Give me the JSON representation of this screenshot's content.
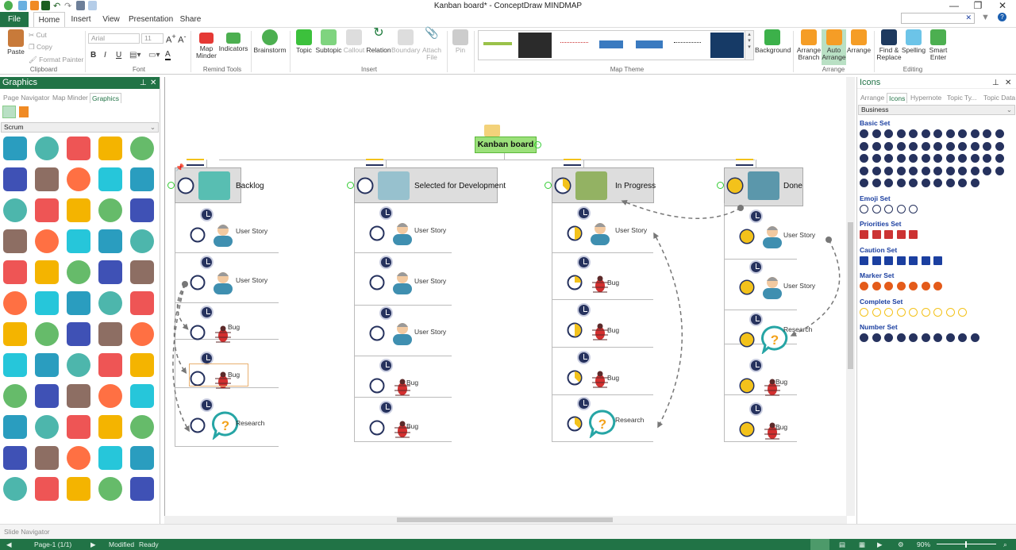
{
  "window": {
    "title": "Kanban board* - ConceptDraw MINDMAP",
    "minimize": "—",
    "restore": "❐",
    "close": "✕"
  },
  "tabs": {
    "file": "File",
    "items": [
      "Home",
      "Insert",
      "View",
      "Presentation",
      "Share"
    ]
  },
  "ribbon": {
    "clipboard": {
      "paste": "Paste",
      "cut": "Cut",
      "copy": "Copy",
      "format_painter": "Format Painter",
      "label": "Clipboard"
    },
    "font": {
      "name": "Arial",
      "size": "11",
      "bold": "B",
      "italic": "I",
      "underline": "U",
      "color": "A",
      "label": "Font"
    },
    "remind": {
      "map_minder": "Map Minder",
      "indicators": "Indicators",
      "label": "Remind Tools"
    },
    "brainstorm": "Brainstorm",
    "insert": {
      "items": [
        "Topic",
        "Subtopic",
        "Callout",
        "Relation",
        "Boundary",
        "Attach File"
      ],
      "label": "Insert"
    },
    "pin": "Pin",
    "map_theme": {
      "label": "Map Theme",
      "background": "Background"
    },
    "arrange": {
      "items": [
        "Arrange Branch",
        "Auto Arrange",
        "Arrange"
      ],
      "label": "Arrange"
    },
    "editing": {
      "items": [
        "Find & Replace",
        "Spelling",
        "Smart Enter"
      ],
      "label": "Editing"
    }
  },
  "left_panel": {
    "title": "Graphics",
    "tabs": [
      "Page Navigator",
      "Map Minder",
      "Graphics"
    ],
    "category": "Scrum",
    "icons": [
      "checklist",
      "gear",
      "chat-alert",
      "calendar",
      "businessman",
      "team",
      "bug",
      "chart-down",
      "chart-up",
      "manager",
      "team-meeting",
      "signpost",
      "document-check",
      "gears-people",
      "speech-question",
      "document",
      "check-circle",
      "worker-laptop",
      "ruler-triangle",
      "exclamation",
      "lock",
      "growth-chart",
      "dots-circle",
      "down-arrow",
      "ellipsis-circle",
      "mvp-box",
      "settings-people",
      "truck",
      "warning",
      "list-panel",
      "person-box",
      "open-box",
      "question-bubble",
      "question-bubbles",
      "error-circle",
      "pencil-ruler",
      "hand-document",
      "kanban-board",
      "presenter",
      "team-circle",
      "network",
      "sticky-notes",
      "cycle-person",
      "refresh-arrow",
      "task-list",
      "target",
      "sticky-note",
      "circular-arrow",
      "money-gears",
      "meeting-group",
      "leader-flag",
      "businessman-2",
      "thumbs-down",
      "thumbs-up",
      "clock",
      "clipboard",
      "magnifier",
      "id-card",
      "gauge",
      "eye"
    ]
  },
  "canvas": {
    "root": "Kanban board",
    "columns": [
      {
        "title": "Backlog",
        "progress": 0,
        "items": [
          {
            "label": "User Story",
            "type": "user",
            "progress": 0
          },
          {
            "label": "User Story",
            "type": "user",
            "progress": 0
          },
          {
            "label": "Bug",
            "type": "bug",
            "progress": 0
          },
          {
            "label": "Bug",
            "type": "bug",
            "progress": 0
          },
          {
            "label": "Research",
            "type": "question",
            "progress": 0
          }
        ]
      },
      {
        "title": "Selected for Development",
        "progress": 0,
        "items": [
          {
            "label": "User Story",
            "type": "user",
            "progress": 0
          },
          {
            "label": "User Story",
            "type": "user",
            "progress": 0
          },
          {
            "label": "User Story",
            "type": "user",
            "progress": 0
          },
          {
            "label": "Bug",
            "type": "bug",
            "progress": 0
          },
          {
            "label": "Bug",
            "type": "bug",
            "progress": 0
          }
        ]
      },
      {
        "title": "In Progress",
        "progress": 0.375,
        "items": [
          {
            "label": "User Story",
            "type": "user",
            "progress": 0.5
          },
          {
            "label": "Bug",
            "type": "bug",
            "progress": 0.25
          },
          {
            "label": "Bug",
            "type": "bug",
            "progress": 0.5
          },
          {
            "label": "Bug",
            "type": "bug",
            "progress": 0.375
          },
          {
            "label": "Research",
            "type": "question",
            "progress": 0.375
          }
        ]
      },
      {
        "title": "Done",
        "progress": 1,
        "items": [
          {
            "label": "User Story",
            "type": "user",
            "progress": 1
          },
          {
            "label": "User Story",
            "type": "user",
            "progress": 1
          },
          {
            "label": "Research",
            "type": "question",
            "progress": 1
          },
          {
            "label": "Bug",
            "type": "bug",
            "progress": 1
          },
          {
            "label": "Bug",
            "type": "bug",
            "progress": 1
          }
        ]
      }
    ]
  },
  "right_panel": {
    "title": "Icons",
    "tabs": [
      "Arrange",
      "Icons",
      "Hypernote",
      "Topic Ty...",
      "Topic Data"
    ],
    "category": "Business",
    "sets": [
      {
        "name": "Basic Set",
        "count": 58,
        "color": "#26325e"
      },
      {
        "name": "Emoji Set",
        "count": 5,
        "color": "#26325e"
      },
      {
        "name": "Priorities Set",
        "count": 5,
        "color": "#c33"
      },
      {
        "name": "Caution Set",
        "count": 7,
        "color": "#1b3fa0"
      },
      {
        "name": "Marker Set",
        "count": 7,
        "color": "#e45b1a"
      },
      {
        "name": "Complete Set",
        "count": 9,
        "color": "#f3c21b"
      },
      {
        "name": "Number Set",
        "count": 10,
        "color": "#26325e"
      }
    ]
  },
  "slide_navigator": "Slide Navigator",
  "status": {
    "page": "Page-1 (1/1)",
    "modified": "Modified",
    "ready": "Ready",
    "zoom": "90%"
  },
  "colors": {
    "brand": "#217346",
    "node": "#dddddd",
    "root": "#9be07a",
    "navy": "#26325e",
    "yellow": "#f3c21b"
  }
}
